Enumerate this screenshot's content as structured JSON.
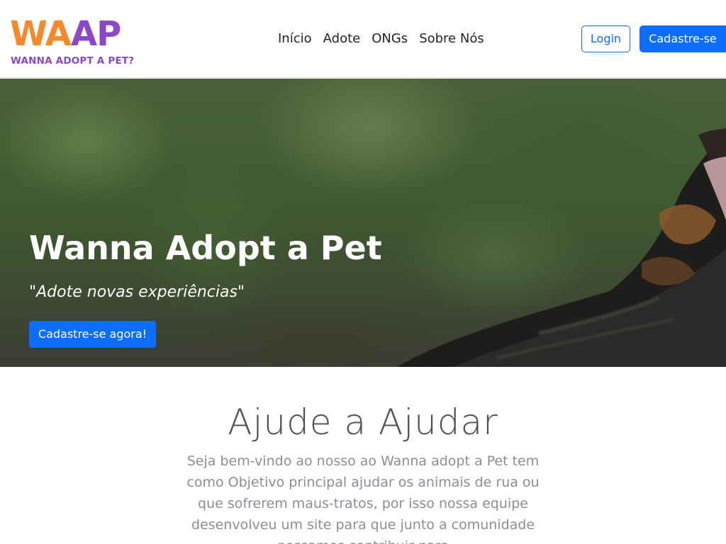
{
  "brand": {
    "logo_main_part1": "WA",
    "logo_main_part2": "AP",
    "logo_sub": "WANNA ADOPT A PET?",
    "colors": {
      "orange": "#f58a2c",
      "purple": "#8a48c8"
    }
  },
  "nav": {
    "links": [
      "Início",
      "Adote",
      "ONGs",
      "Sobre Nós"
    ],
    "login_label": "Login",
    "signup_label": "Cadastre-se"
  },
  "hero": {
    "title": "Wanna Adopt a Pet",
    "quote_open": "\"",
    "quote_text": "Adote novas experiências",
    "quote_close": "\"",
    "cta_label": "Cadastre-se agora!"
  },
  "about": {
    "title": "Ajude a Ajudar",
    "text": "Seja bem-vindo ao nosso ao Wanna adopt a Pet tem como Objetivo principal ajudar os animais de rua ou que sofrerem maus-tratos, por isso nossa equipe desenvolveu um site para que junto a comunidade possamos contribuir para"
  },
  "colors": {
    "primary": "#0d6efd"
  }
}
